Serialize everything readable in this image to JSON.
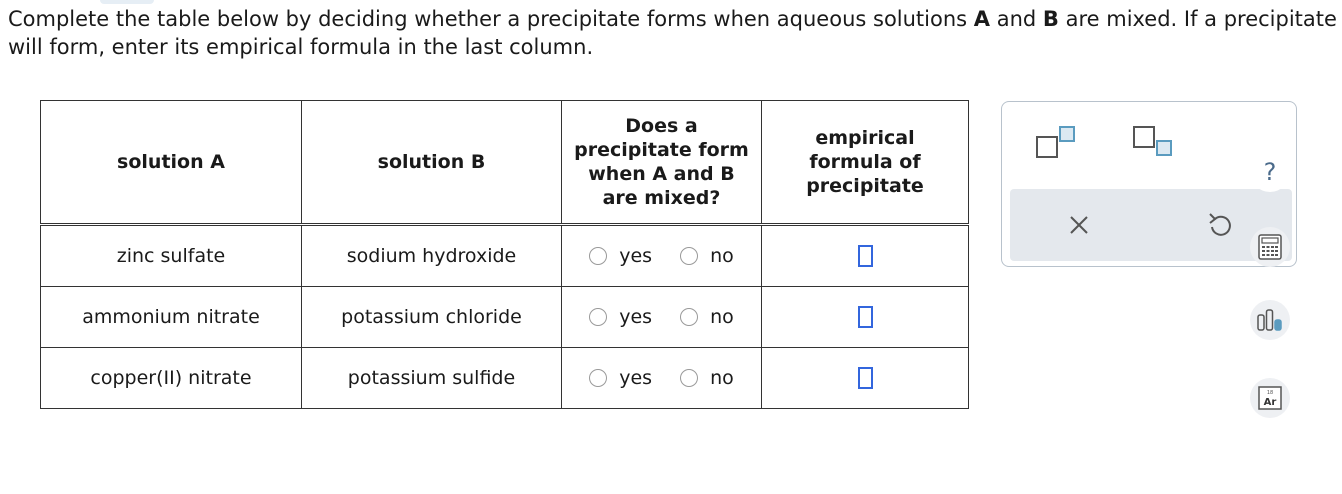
{
  "instructions": {
    "part1": "Complete the table below by deciding whether a precipitate forms when aqueous solutions ",
    "a": "A",
    "part2": " and ",
    "b": "B",
    "part3": " are mixed. If a precipitate will form, enter its empirical formula in the last column."
  },
  "table": {
    "headers": {
      "solution_a": "solution A",
      "solution_b": "solution B",
      "precip_line1": "Does a",
      "precip_line2": "precipitate form",
      "precip_line3": "when A and B",
      "precip_line4": "are mixed?",
      "formula_line1": "empirical",
      "formula_line2": "formula of",
      "formula_line3": "precipitate"
    },
    "rows": [
      {
        "solution_a": "zinc sulfate",
        "solution_b": "sodium hydroxide",
        "yes": "yes",
        "no": "no"
      },
      {
        "solution_a": "ammonium nitrate",
        "solution_b": "potassium chloride",
        "yes": "yes",
        "no": "no"
      },
      {
        "solution_a": "copper(II) nitrate",
        "solution_b": "potassium sulfide",
        "yes": "yes",
        "no": "no"
      }
    ]
  },
  "palette": {
    "buttons": [
      "superscript-template-icon",
      "subscript-template-icon",
      "clear-icon",
      "undo-icon"
    ]
  },
  "side_tools": {
    "help": "?",
    "periodic_label": "Ar",
    "periodic_number": "18"
  },
  "colors": {
    "answer_box": "#3366dd",
    "palette_icon": "#5a9bbf",
    "palette_bg": "#e4e8ed"
  }
}
